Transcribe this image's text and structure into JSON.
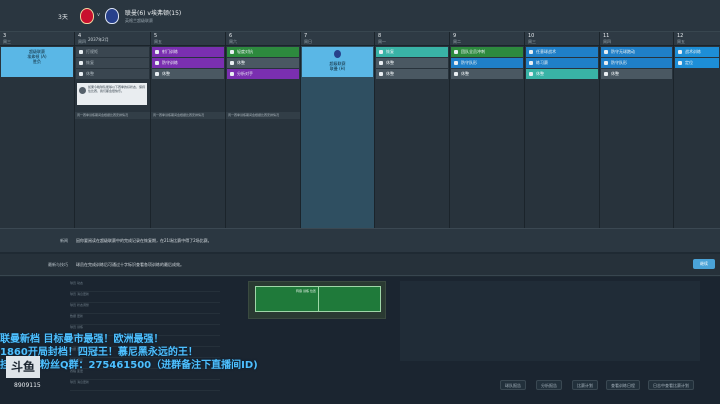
{
  "header": {
    "days_left": "3天",
    "vs": "v",
    "match_title": "联曼(6) v埃弗顿(15)",
    "match_sub": "英格兰超级联赛"
  },
  "calendar": {
    "days": [
      {
        "num": "3",
        "name": "周三",
        "date": ""
      },
      {
        "num": "4",
        "name": "周四",
        "date": "2037年2月"
      },
      {
        "num": "5",
        "name": "周五",
        "date": ""
      },
      {
        "num": "6",
        "name": "周六",
        "date": ""
      },
      {
        "num": "7",
        "name": "周日",
        "date": ""
      },
      {
        "num": "8",
        "name": "周一",
        "date": ""
      },
      {
        "num": "9",
        "name": "周二",
        "date": ""
      },
      {
        "num": "10",
        "name": "周三",
        "date": ""
      },
      {
        "num": "11",
        "name": "周四",
        "date": ""
      },
      {
        "num": "12",
        "name": "周五",
        "date": ""
      }
    ],
    "match_day3": {
      "label": "超级联赛",
      "score": "埃弗顿 (A)",
      "extra": "胜负"
    },
    "match_day7": {
      "label": "超级联赛",
      "score": "联曼 (H)",
      "extra": "主场"
    },
    "day4": {
      "s1": "打规矩",
      "s2": "恢复",
      "s3": "休整"
    },
    "day5": {
      "s1": "射门训练",
      "s2": "防守训练",
      "s3": "休整"
    },
    "day6": {
      "s1": "轻度对抗",
      "s2": "休整",
      "s3": "分析对手"
    },
    "day8": {
      "s1": "恢复",
      "s2": "休整",
      "s3": "休整"
    },
    "day9": {
      "s1": "团队全员冲刺",
      "s2": "防守队形",
      "s3": "休整"
    },
    "day10": {
      "s1": "任意球战术",
      "s2": "练习赛",
      "s3": "休整"
    },
    "day11": {
      "s1": "防守无球跑动",
      "s2": "防守队形",
      "s3": "休整"
    },
    "day12": {
      "s1": "战术训练",
      "s2": "定位",
      "s3": ""
    },
    "comment": "如果今晚球队能够以下赛季的好状态，保持住比赛，我们都会很快乐。",
    "note": "周一赛季训练期间会根据比赛安排情况"
  },
  "info": {
    "label1": "新闻",
    "text1": "因你要阅读在超级联赛中的完成记录在恢复期，在21场比赛中得了2场比赛。",
    "label2": "最新与技巧",
    "text2": "球员在完成训练后可通过十字标识查看各项训练的最后成效。",
    "continue": "继续"
  },
  "lower": {
    "feed": [
      "球员 动态",
      "球员 消息更新",
      "球员 状态调整",
      "数据 更新",
      "球员 训练",
      "球员 伤病报告",
      "数据 更新",
      "球员 评论",
      "赛程 变更",
      "球员 消息更新"
    ],
    "pitch_label": "阵容 训练 位置"
  },
  "overlay": {
    "line1": "联曼新档 目标曼市最强！欧洲最强！",
    "line2": "1860开局封档！四冠王！慕尼黑永远的王！",
    "line3": "挂着开始粉丝Q群：275461500（进群备注下直播间ID)",
    "logo": "斗鱼",
    "room_num": "8909115"
  },
  "bottom_tabs": [
    "球队报告",
    "分析报告",
    "比赛计划",
    "查看训练日程",
    "日志中查看比赛计划"
  ]
}
